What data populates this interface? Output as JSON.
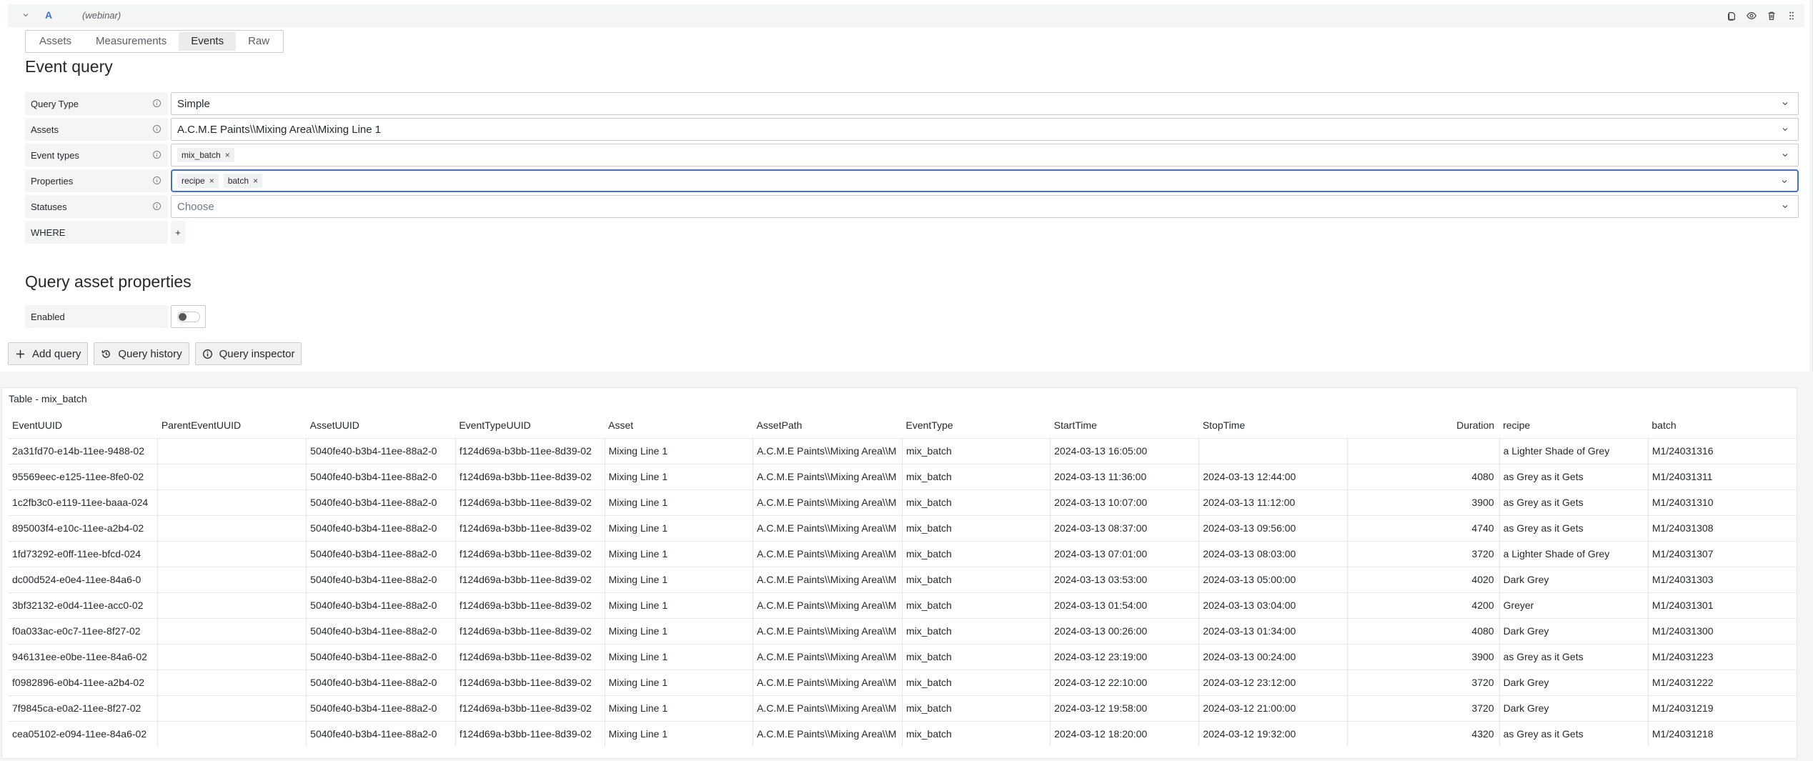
{
  "query_header": {
    "ref_id": "A",
    "datasource": "(webinar)",
    "actions": [
      "duplicate-query",
      "toggle-visibility",
      "delete-query",
      "drag-handle"
    ]
  },
  "tabs": [
    {
      "label": "Assets",
      "active": false
    },
    {
      "label": "Measurements",
      "active": false
    },
    {
      "label": "Events",
      "active": true
    },
    {
      "label": "Raw",
      "active": false
    }
  ],
  "event_query": {
    "title": "Event query",
    "query_type": {
      "label": "Query Type",
      "value": "Simple"
    },
    "assets": {
      "label": "Assets",
      "value": "A.C.M.E Paints\\\\Mixing Area\\\\Mixing Line 1"
    },
    "event_types": {
      "label": "Event types",
      "chips": [
        "mix_batch"
      ]
    },
    "properties": {
      "label": "Properties",
      "chips": [
        "recipe",
        "batch"
      ]
    },
    "statuses": {
      "label": "Statuses",
      "placeholder": "Choose"
    },
    "where": {
      "label": "WHERE",
      "add_label": "+"
    }
  },
  "asset_properties": {
    "title": "Query asset properties",
    "enabled": {
      "label": "Enabled",
      "value": false
    }
  },
  "buttons": {
    "add_query": "Add query",
    "query_history": "Query history",
    "query_inspector": "Query inspector"
  },
  "table": {
    "title": "Table - mix_batch",
    "columns": [
      "EventUUID",
      "ParentEventUUID",
      "AssetUUID",
      "EventTypeUUID",
      "Asset",
      "AssetPath",
      "EventType",
      "StartTime",
      "StopTime",
      "Duration",
      "recipe",
      "batch"
    ],
    "rows": [
      [
        "2a31fd70-e14b-11ee-9488-02",
        "",
        "5040fe40-b3b4-11ee-88a2-0",
        "f124d69a-b3bb-11ee-8d39-02",
        "Mixing Line 1",
        "A.C.M.E Paints\\\\Mixing Area\\\\M",
        "mix_batch",
        "2024-03-13 16:05:00",
        "",
        "",
        "a Lighter Shade of Grey",
        "M1/24031316"
      ],
      [
        "95569eec-e125-11ee-8fe0-02",
        "",
        "5040fe40-b3b4-11ee-88a2-0",
        "f124d69a-b3bb-11ee-8d39-02",
        "Mixing Line 1",
        "A.C.M.E Paints\\\\Mixing Area\\\\M",
        "mix_batch",
        "2024-03-13 11:36:00",
        "2024-03-13 12:44:00",
        "4080",
        "as Grey as it Gets",
        "M1/24031311"
      ],
      [
        "1c2fb3c0-e119-11ee-baaa-024",
        "",
        "5040fe40-b3b4-11ee-88a2-0",
        "f124d69a-b3bb-11ee-8d39-02",
        "Mixing Line 1",
        "A.C.M.E Paints\\\\Mixing Area\\\\M",
        "mix_batch",
        "2024-03-13 10:07:00",
        "2024-03-13 11:12:00",
        "3900",
        "as Grey as it Gets",
        "M1/24031310"
      ],
      [
        "895003f4-e10c-11ee-a2b4-02",
        "",
        "5040fe40-b3b4-11ee-88a2-0",
        "f124d69a-b3bb-11ee-8d39-02",
        "Mixing Line 1",
        "A.C.M.E Paints\\\\Mixing Area\\\\M",
        "mix_batch",
        "2024-03-13 08:37:00",
        "2024-03-13 09:56:00",
        "4740",
        "as Grey as it Gets",
        "M1/24031308"
      ],
      [
        "1fd73292-e0ff-11ee-bfcd-024",
        "",
        "5040fe40-b3b4-11ee-88a2-0",
        "f124d69a-b3bb-11ee-8d39-02",
        "Mixing Line 1",
        "A.C.M.E Paints\\\\Mixing Area\\\\M",
        "mix_batch",
        "2024-03-13 07:01:00",
        "2024-03-13 08:03:00",
        "3720",
        "a Lighter Shade of Grey",
        "M1/24031307"
      ],
      [
        "dc00d524-e0e4-11ee-84a6-0",
        "",
        "5040fe40-b3b4-11ee-88a2-0",
        "f124d69a-b3bb-11ee-8d39-02",
        "Mixing Line 1",
        "A.C.M.E Paints\\\\Mixing Area\\\\M",
        "mix_batch",
        "2024-03-13 03:53:00",
        "2024-03-13 05:00:00",
        "4020",
        "Dark Grey",
        "M1/24031303"
      ],
      [
        "3bf32132-e0d4-11ee-acc0-02",
        "",
        "5040fe40-b3b4-11ee-88a2-0",
        "f124d69a-b3bb-11ee-8d39-02",
        "Mixing Line 1",
        "A.C.M.E Paints\\\\Mixing Area\\\\M",
        "mix_batch",
        "2024-03-13 01:54:00",
        "2024-03-13 03:04:00",
        "4200",
        "Greyer",
        "M1/24031301"
      ],
      [
        "f0a033ac-e0c7-11ee-8f27-02",
        "",
        "5040fe40-b3b4-11ee-88a2-0",
        "f124d69a-b3bb-11ee-8d39-02",
        "Mixing Line 1",
        "A.C.M.E Paints\\\\Mixing Area\\\\M",
        "mix_batch",
        "2024-03-13 00:26:00",
        "2024-03-13 01:34:00",
        "4080",
        "Dark Grey",
        "M1/24031300"
      ],
      [
        "946131ee-e0be-11ee-84a6-02",
        "",
        "5040fe40-b3b4-11ee-88a2-0",
        "f124d69a-b3bb-11ee-8d39-02",
        "Mixing Line 1",
        "A.C.M.E Paints\\\\Mixing Area\\\\M",
        "mix_batch",
        "2024-03-12 23:19:00",
        "2024-03-13 00:24:00",
        "3900",
        "as Grey as it Gets",
        "M1/24031223"
      ],
      [
        "f0982896-e0b4-11ee-a2b4-02",
        "",
        "5040fe40-b3b4-11ee-88a2-0",
        "f124d69a-b3bb-11ee-8d39-02",
        "Mixing Line 1",
        "A.C.M.E Paints\\\\Mixing Area\\\\M",
        "mix_batch",
        "2024-03-12 22:10:00",
        "2024-03-12 23:12:00",
        "3720",
        "Dark Grey",
        "M1/24031222"
      ],
      [
        "7f9845ca-e0a2-11ee-8f27-02",
        "",
        "5040fe40-b3b4-11ee-88a2-0",
        "f124d69a-b3bb-11ee-8d39-02",
        "Mixing Line 1",
        "A.C.M.E Paints\\\\Mixing Area\\\\M",
        "mix_batch",
        "2024-03-12 19:58:00",
        "2024-03-12 21:00:00",
        "3720",
        "Dark Grey",
        "M1/24031219"
      ],
      [
        "cea05102-e094-11ee-84a6-02",
        "",
        "5040fe40-b3b4-11ee-88a2-0",
        "f124d69a-b3bb-11ee-8d39-02",
        "Mixing Line 1",
        "A.C.M.E Paints\\\\Mixing Area\\\\M",
        "mix_batch",
        "2024-03-12 18:20:00",
        "2024-03-12 19:32:00",
        "4320",
        "as Grey as it Gets",
        "M1/24031218"
      ]
    ]
  },
  "colors": {
    "accent": "#3d71d9",
    "panel_bg": "#f4f5f5",
    "border": "#c7cbcf"
  }
}
